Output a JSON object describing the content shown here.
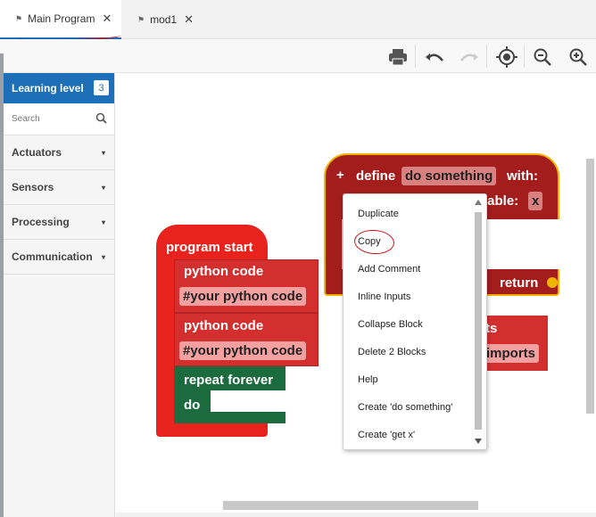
{
  "tabs": [
    {
      "label": "Main Program",
      "close": "✕",
      "active": true
    },
    {
      "label": "mod1",
      "close": "✕",
      "active": false
    }
  ],
  "sidebar": {
    "learning_level_label": "Learning level",
    "learning_level_value": "3",
    "search_placeholder": "Search",
    "categories": [
      {
        "label": "Actuators",
        "caret": "▾"
      },
      {
        "label": "Sensors",
        "caret": "▾"
      },
      {
        "label": "Processing",
        "caret": "▾"
      },
      {
        "label": "Communication",
        "caret": "▾"
      }
    ]
  },
  "blocks": {
    "program_start": "program start",
    "python_code_1": "python code",
    "python_field_1": "#your python code",
    "python_code_2": "python code",
    "python_field_2": "#your python code",
    "repeat_forever": "repeat forever",
    "do": "do",
    "define_plus": "+",
    "define": "define",
    "define_name": "do something",
    "define_with": "with:",
    "variable_partial": "iable:",
    "variable_name": "x",
    "return": "return",
    "partial_ts": "ts",
    "partial_imports": "imports"
  },
  "context_menu": {
    "items": [
      "Duplicate",
      "Copy",
      "Add Comment",
      "Inline Inputs",
      "Collapse Block",
      "Delete 2 Blocks",
      "Help",
      "Create 'do something'",
      "Create 'get x'"
    ]
  },
  "colors": {
    "accent": "#1d6fb8",
    "block_red": "#d32f2f",
    "block_dark_red": "#a31d1d",
    "block_green": "#1b6b3e",
    "field_pink": "#f4a0a0"
  }
}
